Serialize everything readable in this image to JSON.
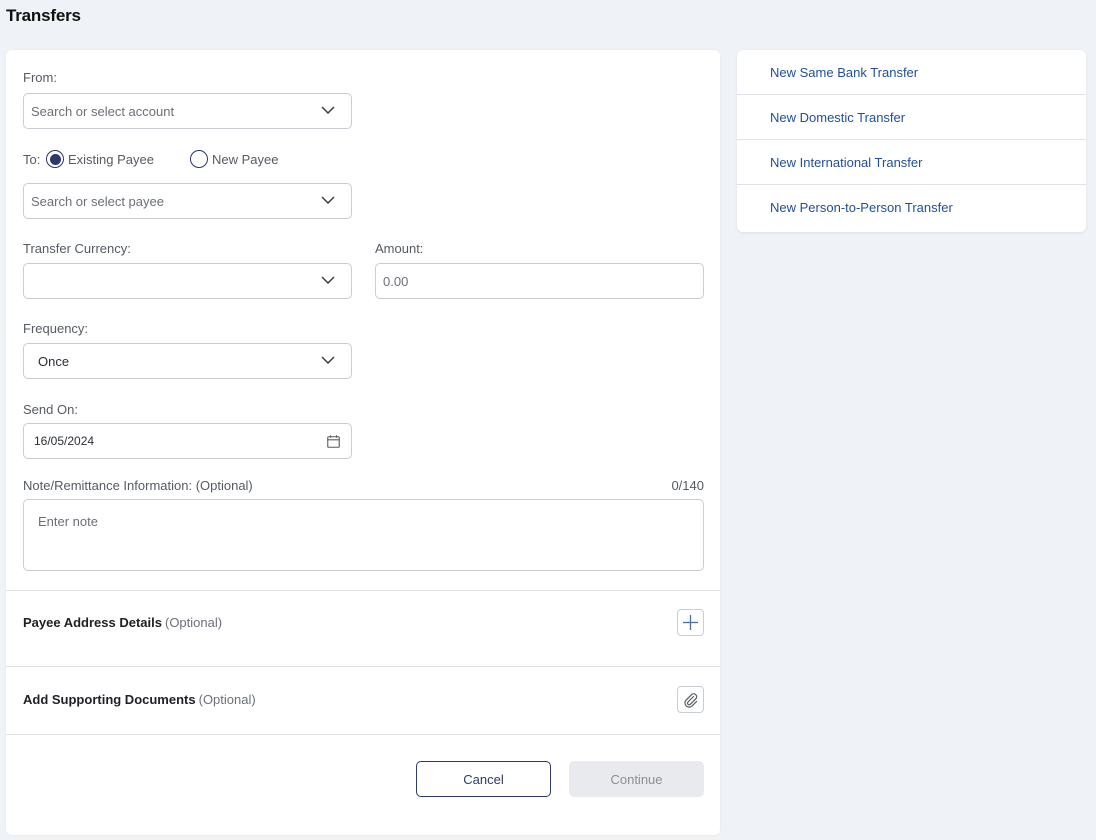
{
  "header": {
    "title": "Transfers"
  },
  "form": {
    "from": {
      "label": "From:",
      "placeholder": "Search or select account"
    },
    "to": {
      "label": "To:",
      "options": [
        {
          "label": "Existing Payee",
          "selected": true
        },
        {
          "label": "New Payee",
          "selected": false
        }
      ],
      "placeholder": "Search or select payee"
    },
    "currency": {
      "label": "Transfer Currency:",
      "value": ""
    },
    "amount": {
      "label": "Amount:",
      "placeholder": "0.00"
    },
    "frequency": {
      "label": "Frequency:",
      "value": "Once"
    },
    "send_on": {
      "label": "Send On:",
      "value": "16/05/2024"
    },
    "note": {
      "label": "Note/Remittance Information: (Optional)",
      "counter": "0/140",
      "placeholder": "Enter note"
    },
    "payee_address": {
      "title": "Payee Address Details",
      "optional": "(Optional)"
    },
    "documents": {
      "title": "Add Supporting Documents",
      "optional": "(Optional)"
    },
    "buttons": {
      "cancel": "Cancel",
      "continue": "Continue"
    }
  },
  "sidebar": {
    "links": [
      {
        "label": "New Same Bank Transfer"
      },
      {
        "label": "New Domestic Transfer"
      },
      {
        "label": "New International Transfer"
      },
      {
        "label": "New Person-to-Person Transfer"
      }
    ]
  },
  "colors": {
    "background": "#eff3f7",
    "link": "#1f4f9a",
    "accent": "#2c3a6b",
    "disabled_bg": "#e8eaed"
  }
}
